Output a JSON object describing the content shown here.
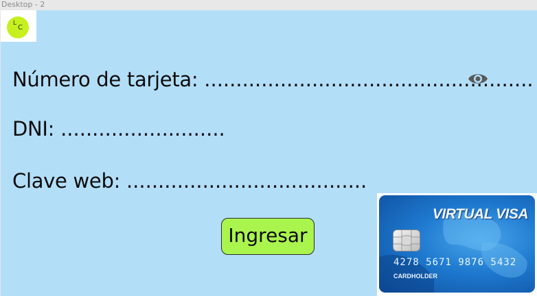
{
  "window": {
    "title": "Desktop - 2"
  },
  "logo": {
    "letter1": "L",
    "letter2": "C"
  },
  "form": {
    "card_number_label": "Número de tarjeta:",
    "card_number_value": "....................................................",
    "dni_label": "DNI:",
    "dni_value": "..........................",
    "web_key_label": "Clave web:",
    "web_key_value": "......................................",
    "submit_label": "Ingresar"
  },
  "icons": {
    "toggle_visibility": "eye-icon",
    "chip": "chip-icon"
  },
  "card": {
    "brand": "VIRTUAL VISA",
    "number": "4278 5671 9876 5432",
    "holder": "CARDHOLDER"
  },
  "colors": {
    "background": "#b3def8",
    "logo_accent": "#c6f01e",
    "button": "#aaf44e",
    "card_blue": "#1e79cf"
  }
}
